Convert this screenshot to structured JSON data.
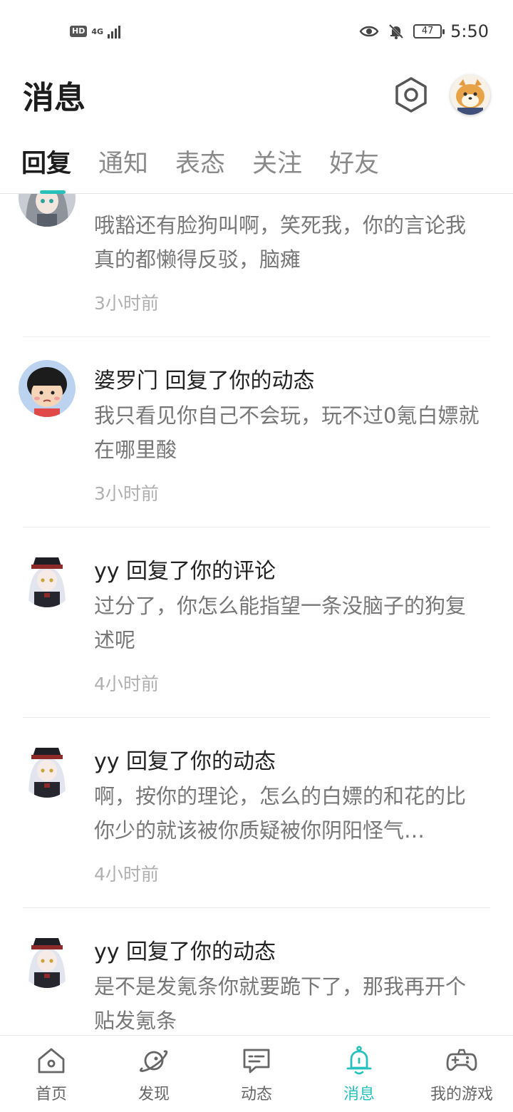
{
  "status_bar": {
    "hd": "HD",
    "network": "4G",
    "battery": "47",
    "time": "5:50"
  },
  "header": {
    "title": "消息",
    "settings_icon": "settings-hexagon-icon",
    "avatar": "shiba-dog-avatar"
  },
  "tabs": [
    {
      "label": "回复",
      "active": true
    },
    {
      "label": "通知",
      "active": false
    },
    {
      "label": "表态",
      "active": false
    },
    {
      "label": "关注",
      "active": false
    },
    {
      "label": "好友",
      "active": false
    }
  ],
  "messages": [
    {
      "title": "",
      "body": "哦豁还有脸狗叫啊，笑死我，你的言论我真的都懒得反驳，脑瘫",
      "time": "3小时前",
      "avatar": "anime-girl-gray-hair"
    },
    {
      "title": "婆罗门 回复了你的动态",
      "body": "我只看见你自己不会玩，玩不过0氪白嫖就在哪里酸",
      "time": "3小时前",
      "avatar": "cartoon-girl-black-hair"
    },
    {
      "title": "yy 回复了你的评论",
      "body": "过分了，你怎么能指望一条没脑子的狗复述呢",
      "time": "4小时前",
      "avatar": "anime-girl-soldier"
    },
    {
      "title": "yy 回复了你的动态",
      "body": "啊，按你的理论，怎么的白嫖的和花的比你少的就该被你质疑被你阴阳怪气…",
      "time": "4小时前",
      "avatar": "anime-girl-soldier"
    },
    {
      "title": "yy 回复了你的动态",
      "body": "是不是发氪条你就要跪下了，那我再开个贴发氪条",
      "time": "",
      "avatar": "anime-girl-soldier"
    }
  ],
  "bottom_nav": [
    {
      "label": "首页",
      "icon": "home-icon",
      "active": false
    },
    {
      "label": "发现",
      "icon": "planet-icon",
      "active": false
    },
    {
      "label": "动态",
      "icon": "chat-icon",
      "active": false
    },
    {
      "label": "消息",
      "icon": "bell-icon",
      "active": true
    },
    {
      "label": "我的游戏",
      "icon": "gamepad-icon",
      "active": false
    }
  ],
  "colors": {
    "accent": "#27c1bc",
    "text_primary": "#222222",
    "text_secondary": "#777777",
    "text_time": "#b0b0b0"
  }
}
